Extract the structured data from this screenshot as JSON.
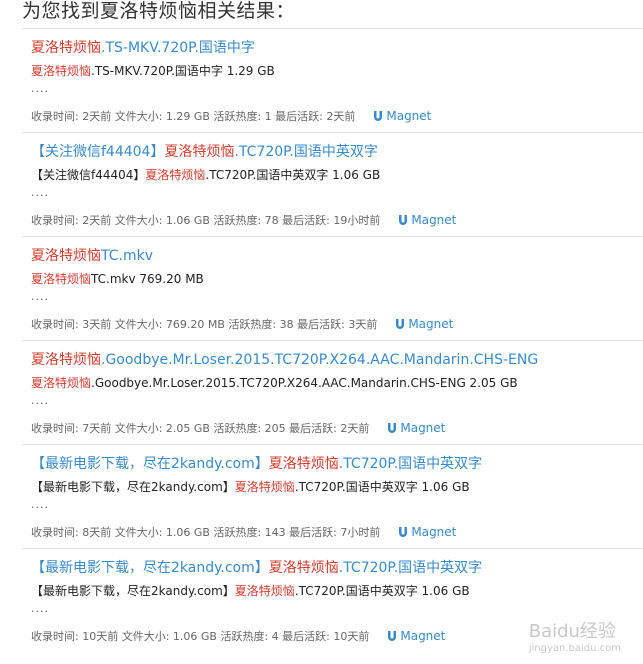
{
  "heading": "为您找到夏洛特烦恼相关结果：",
  "results": [
    {
      "title_prefix": "",
      "title_hl": "夏洛特烦恼",
      "title_suffix": ".TS-MKV.720P.国语中字",
      "desc_prefix": "",
      "desc_hl": "夏洛特烦恼",
      "desc_suffix": ".TS-MKV.720P.国语中字 1.29 GB",
      "dots": "....",
      "meta": "收录时间: 2天前 文件大小: 1.29 GB 活跃热度: 1 最后活跃: 2天前",
      "magnet": "Magnet"
    },
    {
      "title_prefix": "【关注微信f44404】",
      "title_hl": "夏洛特烦恼",
      "title_suffix": ".TC720P.国语中英双字",
      "desc_prefix": "【关注微信f44404】",
      "desc_hl": "夏洛特烦恼",
      "desc_suffix": ".TC720P.国语中英双字 1.06 GB",
      "dots": "....",
      "meta": "收录时间: 2天前 文件大小: 1.06 GB 活跃热度: 78 最后活跃: 19小时前",
      "magnet": "Magnet"
    },
    {
      "title_prefix": "",
      "title_hl": "夏洛特烦恼",
      "title_suffix": "TC.mkv",
      "desc_prefix": "",
      "desc_hl": "夏洛特烦恼",
      "desc_suffix": "TC.mkv 769.20 MB",
      "dots": "....",
      "meta": "收录时间: 3天前 文件大小: 769.20 MB 活跃热度: 38 最后活跃: 3天前",
      "magnet": "Magnet"
    },
    {
      "title_prefix": "",
      "title_hl": "夏洛特烦恼",
      "title_suffix": ".Goodbye.Mr.Loser.2015.TC720P.X264.AAC.Mandarin.CHS-ENG",
      "desc_prefix": "",
      "desc_hl": "夏洛特烦恼",
      "desc_suffix": ".Goodbye.Mr.Loser.2015.TC720P.X264.AAC.Mandarin.CHS-ENG 2.05 GB",
      "dots": "....",
      "meta": "收录时间: 7天前 文件大小: 2.05 GB 活跃热度: 205 最后活跃: 2天前",
      "magnet": "Magnet"
    },
    {
      "title_prefix": "【最新电影下载，尽在2kandy.com】",
      "title_hl": "夏洛特烦恼",
      "title_suffix": ".TC720P.国语中英双字",
      "desc_prefix": "【最新电影下载，尽在2kandy.com】",
      "desc_hl": "夏洛特烦恼",
      "desc_suffix": ".TC720P.国语中英双字 1.06 GB",
      "dots": "....",
      "meta": "收录时间: 8天前 文件大小: 1.06 GB 活跃热度: 143 最后活跃: 7小时前",
      "magnet": "Magnet"
    },
    {
      "title_prefix": "【最新电影下载，尽在2kandy.com】",
      "title_hl": "夏洛特烦恼",
      "title_suffix": ".TC720P.国语中英双字",
      "desc_prefix": "【最新电影下载，尽在2kandy.com】",
      "desc_hl": "夏洛特烦恼",
      "desc_suffix": ".TC720P.国语中英双字 1.06 GB",
      "dots": "....",
      "meta": "收录时间: 10天前 文件大小: 1.06 GB 活跃热度: 4 最后活跃: 10天前",
      "magnet": "Magnet"
    }
  ],
  "colors": {
    "link": "#3a8ac9",
    "highlight": "#d13b2b",
    "divider": "#e3e3e3"
  },
  "watermark": {
    "brand": "Baidu经验",
    "url": "jingyan.baidu.com"
  }
}
